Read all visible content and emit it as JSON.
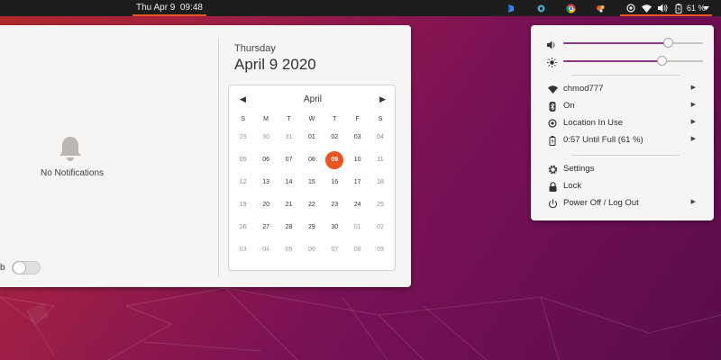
{
  "topbar": {
    "clock": "Thu Apr 9  09:48",
    "battery_percent": "61 %"
  },
  "calendar_popover": {
    "notifications": {
      "empty_text": "No Notifications",
      "dnd_label": "b"
    },
    "weekday": "Thursday",
    "date": "April 9 2020",
    "calendar": {
      "month": "April",
      "day_headers": [
        "S",
        "M",
        "T",
        "W",
        "T",
        "F",
        "S"
      ],
      "weeks": [
        [
          "29",
          "30",
          "31",
          "01",
          "02",
          "03",
          "04"
        ],
        [
          "05",
          "06",
          "07",
          "08",
          "09",
          "10",
          "11"
        ],
        [
          "12",
          "13",
          "14",
          "15",
          "16",
          "17",
          "18"
        ],
        [
          "19",
          "20",
          "21",
          "22",
          "23",
          "24",
          "25"
        ],
        [
          "26",
          "27",
          "28",
          "29",
          "30",
          "01",
          "02"
        ],
        [
          "03",
          "04",
          "05",
          "06",
          "07",
          "08",
          "09"
        ]
      ],
      "today": "09"
    }
  },
  "system_menu": {
    "volume_level": 0.75,
    "brightness_level": 0.7,
    "items": [
      {
        "label": "chmod777",
        "icon": "wifi-icon",
        "submenu": true
      },
      {
        "label": "On",
        "icon": "bluetooth-icon",
        "submenu": true
      },
      {
        "label": "Location In Use",
        "icon": "location-icon",
        "submenu": true
      },
      {
        "label": "0:57 Until Full (61 %)",
        "icon": "battery-charging-icon",
        "submenu": true
      },
      {
        "label": "Settings",
        "icon": "gear-icon",
        "submenu": false
      },
      {
        "label": "Lock",
        "icon": "lock-icon",
        "submenu": false
      },
      {
        "label": "Power Off / Log Out",
        "icon": "power-icon",
        "submenu": true
      }
    ]
  },
  "colors": {
    "accent": "#e95420",
    "slider": "#8e3a83",
    "panel": "#1d1d1d"
  }
}
